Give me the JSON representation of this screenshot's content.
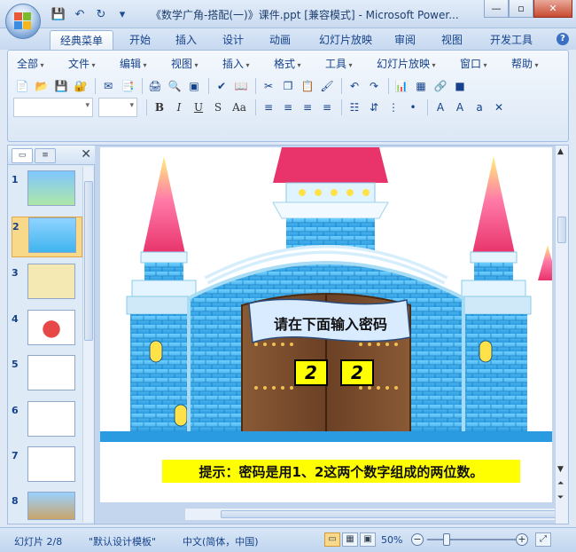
{
  "window": {
    "title": "《数学广角-搭配(一)》课件.ppt [兼容模式] - Microsoft Power...",
    "minimize": "—",
    "maximize": "▫",
    "close": "✕"
  },
  "ribbon_tabs": [
    "经典菜单",
    "开始",
    "插入",
    "设计",
    "动画",
    "幻灯片放映",
    "审阅",
    "视图",
    "开发工具"
  ],
  "menus": [
    "全部",
    "文件",
    "编辑",
    "视图",
    "插入",
    "格式",
    "工具",
    "幻灯片放映",
    "窗口",
    "帮助"
  ],
  "format_buttons": [
    "B",
    "I",
    "U",
    "S",
    "Aa"
  ],
  "panel": {
    "slides": [
      {
        "num": "1"
      },
      {
        "num": "2"
      },
      {
        "num": "3"
      },
      {
        "num": "4"
      },
      {
        "num": "5"
      },
      {
        "num": "6"
      },
      {
        "num": "7"
      },
      {
        "num": "8"
      }
    ],
    "selected": 2
  },
  "slide": {
    "sign_text": "请在下面输入密码",
    "digit1": "2",
    "digit2": "2",
    "hint": "提示：密码是用1、2这两个数字组成的两位数。"
  },
  "status": {
    "slide_info": "幻灯片 2/8",
    "template": "\"默认设计模板\"",
    "language": "中文(简体，中国)",
    "zoom": "50%"
  },
  "colors": {
    "castle_blue": "#3fb4ef",
    "roof_red": "#e8336b",
    "door_brown": "#7a4b2b",
    "highlight_yellow": "#ffff00"
  }
}
